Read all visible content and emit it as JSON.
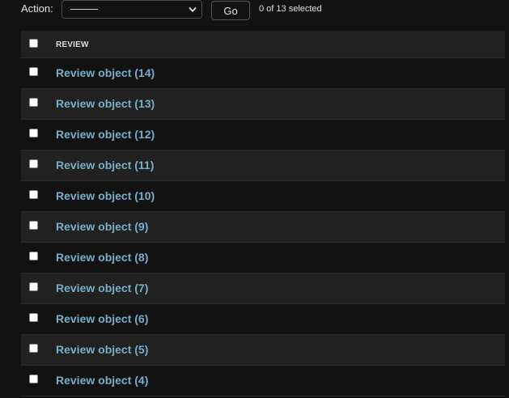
{
  "actions": {
    "label": "Action:",
    "select_value": "---------",
    "go_label": "Go",
    "counter": "0 of 13 selected"
  },
  "table": {
    "header": "REVIEW",
    "rows": [
      "Review object (14)",
      "Review object (13)",
      "Review object (12)",
      "Review object (11)",
      "Review object (10)",
      "Review object (9)",
      "Review object (8)",
      "Review object (7)",
      "Review object (6)",
      "Review object (5)",
      "Review object (4)"
    ]
  },
  "icons": {
    "select_arrow": "chevron-down-icon"
  },
  "colors": {
    "background": "#121212",
    "row_alt": "#212121",
    "link": "#79aec8"
  }
}
